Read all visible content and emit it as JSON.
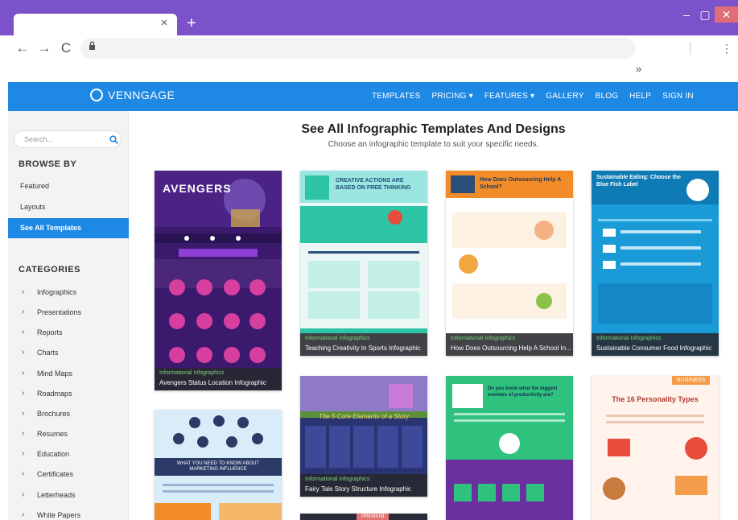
{
  "browser": {
    "new_tab": "+",
    "tab_close": "×",
    "window_minimize": "–",
    "window_maximize": "▢",
    "window_close": "✕",
    "back": "←",
    "forward": "→",
    "reload": "C",
    "lock_icon": "🔒",
    "bookmarks_overflow": "»",
    "menu": "⋮"
  },
  "site": {
    "logo_text": "VENNGAGE",
    "nav": [
      "TEMPLATES",
      "PRICING ▾",
      "FEATURES ▾",
      "GALLERY",
      "BLOG",
      "HELP",
      "SIGN IN"
    ]
  },
  "sidebar": {
    "search_placeholder": "Search...",
    "browse_heading": "BROWSE BY",
    "browse_items": [
      "Featured",
      "Layouts",
      "See All Templates"
    ],
    "categories_heading": "CATEGORIES",
    "categories": [
      "Infographics",
      "Presentations",
      "Reports",
      "Charts",
      "Mind Maps",
      "Roadmaps",
      "Brochures",
      "Resumes",
      "Education",
      "Certificates",
      "Letterheads",
      "White Papers"
    ]
  },
  "main": {
    "title": "See All Infographic Templates And Designs",
    "subtitle": "Choose an infographic template to suit your specific needs.",
    "cards": [
      {
        "category": "Informational Infographics",
        "title": "Avengers Status Location Infographic",
        "art_title": "AVENGERS",
        "colors": [
          "#3b1a6e",
          "#6b2fa0"
        ]
      },
      {
        "category": "Informational Infographics",
        "title": "Teaching Creativity In Sports Infographic",
        "art_title": "CREATIVE ACTIONS ARE BASED ON FREE THINKING",
        "colors": [
          "#9be6e0",
          "#2ec4a6"
        ]
      },
      {
        "category": "Informational Infographics",
        "title": "How Does Outsourcing Help A School In...",
        "art_title": "How Does Outsourcing Help A School?",
        "colors": [
          "#fff",
          "#f28c28"
        ]
      },
      {
        "category": "Informational Infographics",
        "title": "Sustainable Consumer Food Infographic",
        "art_title": "Sustainable Eating: Choose the Blue Fish Label",
        "colors": [
          "#1a9bd7",
          "#0f7bb5"
        ]
      },
      {
        "category": "",
        "title": "",
        "art_title": "WHAT YOU NEED TO KNOW ABOUT MARKETING INFLUENCE",
        "colors": [
          "#d9ecf9",
          "#2b3a67"
        ]
      },
      {
        "category": "Informational Infographics",
        "title": "Fairy Tale Story Structure Infographic",
        "art_title": "The 5 Core Elements of a Story",
        "colors": [
          "#3d4a9a",
          "#2a3472"
        ]
      },
      {
        "category": "",
        "title": "",
        "art_title": "Do you know what the biggest enemies of productivity are?",
        "colors": [
          "#2ec27e",
          "#6b2fa0"
        ]
      },
      {
        "category": "",
        "title": "",
        "art_title": "The 16 Personality Types",
        "colors": [
          "#fff3ec",
          "#f39c4a"
        ]
      }
    ],
    "badges": {
      "business": "BUSINESS",
      "premium": "PREMIUM"
    }
  }
}
